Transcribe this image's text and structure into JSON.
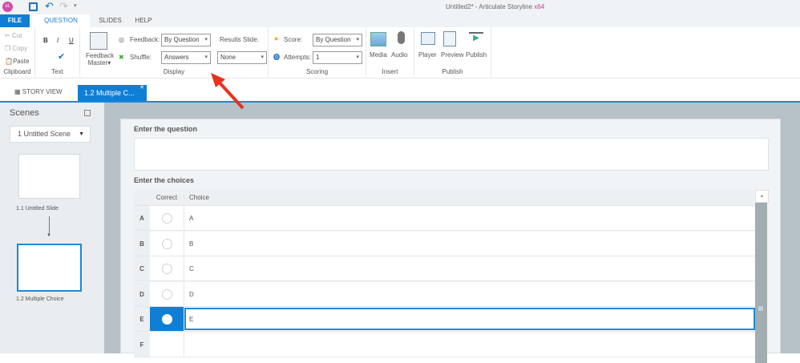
{
  "titlebar": {
    "app_icon": "sL",
    "title": "Untitled2* -  Articulate Storyline",
    "arch": "x64"
  },
  "ribbon_tabs": [
    {
      "label": "FILE"
    },
    {
      "label": "QUESTION"
    },
    {
      "label": "SLIDES"
    },
    {
      "label": "HELP"
    }
  ],
  "clipboard": {
    "cut": "Cut",
    "copy": "Copy",
    "paste": "Paste",
    "label": "Clipboard"
  },
  "text": {
    "bold": "B",
    "italic": "I",
    "underline": "U",
    "label": "Text"
  },
  "display": {
    "feedback_master": "Feedback",
    "feedback_master2": "Master",
    "feedback_label": "Feedback:",
    "feedback_value": "By Question",
    "shuffle_label": "Shuffle:",
    "shuffle_value": "Answers",
    "results_label": "Results Slide:",
    "results_value": "None",
    "label": "Display"
  },
  "scoring": {
    "score_label": "Score:",
    "score_value": "By Question",
    "attempts_label": "Attempts:",
    "attempts_value": "1",
    "label": "Scoring"
  },
  "insert": {
    "media": "Media",
    "audio": "Audio",
    "label": "Insert"
  },
  "publish": {
    "player": "Player",
    "preview": "Preview",
    "publish": "Publish",
    "label": "Publish"
  },
  "doc_tabs": {
    "story_view": "STORY VIEW",
    "active": "1.2 Multiple C..."
  },
  "sidebar": {
    "title": "Scenes",
    "scene_select": "1 Untitled Scene",
    "slides": [
      {
        "label": "1.1 Untitled Slide"
      },
      {
        "label": "1.2 Multiple Choice"
      }
    ]
  },
  "editor": {
    "question_heading": "Enter the question",
    "question_value": "",
    "choices_heading": "Enter the choices",
    "col_correct": "Correct",
    "col_choice": "Choice",
    "rows": [
      {
        "letter": "A",
        "choice": "A",
        "correct": false
      },
      {
        "letter": "B",
        "choice": "B",
        "correct": false
      },
      {
        "letter": "C",
        "choice": "C",
        "correct": false
      },
      {
        "letter": "D",
        "choice": "D",
        "correct": false
      },
      {
        "letter": "E",
        "choice": "E",
        "correct": true
      },
      {
        "letter": "F",
        "choice": "",
        "correct": false
      }
    ]
  },
  "colors": {
    "accent": "#0f7fd6",
    "annotation": "#e8321e"
  }
}
